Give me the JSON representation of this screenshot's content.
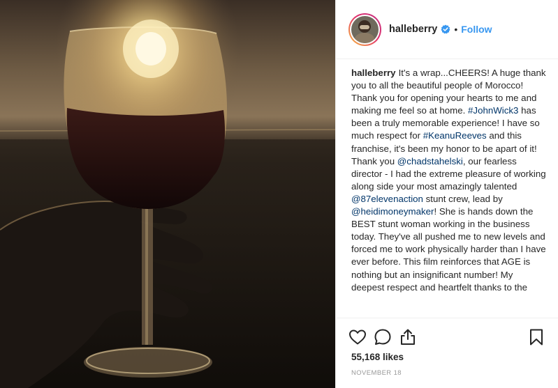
{
  "post": {
    "image": {
      "description_icon": "wine-glass-sunset-photo"
    },
    "header": {
      "username": "halleberry",
      "verified_icon": "verified-badge-icon",
      "separator": "•",
      "follow_label": "Follow"
    },
    "caption": {
      "username": "halleberry",
      "segments": [
        {
          "text": "It's a wrap...CHEERS! A huge thank you to all the beautiful people of Morocco! Thank you for opening your hearts to me and making me feel so at home.  "
        },
        {
          "text": "#JohnWick3",
          "tag": true
        },
        {
          "text": " has been a truly memorable experience!  I have so much respect for "
        },
        {
          "text": "#KeanuReeves",
          "tag": true
        },
        {
          "text": " and this franchise, it's been my honor to be apart of it! Thank you "
        },
        {
          "text": "@chadstahelski",
          "tag": true
        },
        {
          "text": ", our fearless director - I had the extreme pleasure of working along side your most amazingly talented "
        },
        {
          "text": "@87elevenaction",
          "tag": true
        },
        {
          "text": " stunt crew, lead by "
        },
        {
          "text": "@heidimoneymaker",
          "tag": true
        },
        {
          "text": "! She is hands down the BEST stunt woman working in the business today. They've all pushed me to new levels and forced me to work physically harder than I have ever before. This film reinforces that AGE is nothing but an insignificant number! My deepest respect and heartfelt thanks to the"
        }
      ]
    },
    "actions": {
      "like_icon": "heart-icon",
      "comment_icon": "comment-icon",
      "share_icon": "share-icon",
      "save_icon": "bookmark-icon"
    },
    "likes_text": "55,168 likes",
    "date_text": "NOVEMBER 18"
  },
  "colors": {
    "link_blue": "#3897f0",
    "tag_blue": "#003569",
    "text": "#262626",
    "muted": "#999999"
  }
}
